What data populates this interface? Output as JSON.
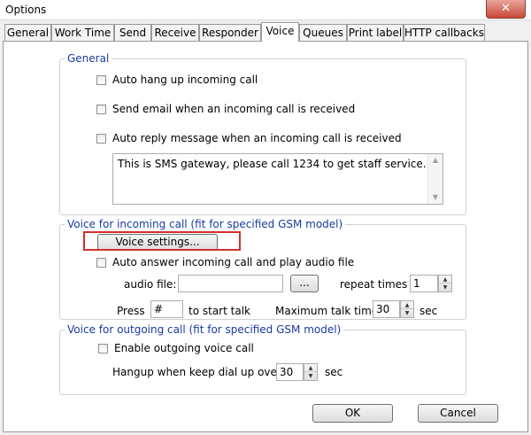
{
  "window": {
    "title": "Options",
    "close_glyph": "✕"
  },
  "tabs": [
    {
      "label": "General"
    },
    {
      "label": "Work Time"
    },
    {
      "label": "Send"
    },
    {
      "label": "Receive"
    },
    {
      "label": "Responder"
    },
    {
      "label": "Voice",
      "active": true
    },
    {
      "label": "Queues"
    },
    {
      "label": "Print label"
    },
    {
      "label": "HTTP callbacks"
    }
  ],
  "general": {
    "legend": "General",
    "auto_hangup_label": "Auto hang up incoming call",
    "send_email_label": "Send email when an incoming call is received",
    "auto_reply_label": "Auto reply message when an incoming call is received",
    "reply_message": "This is SMS gateway, please call 1234 to get staff service."
  },
  "incoming": {
    "legend": "Voice for incoming call (fit for specified GSM model)",
    "voice_settings_label": "Voice settings...",
    "auto_answer_label": "Auto answer incoming call and play audio file",
    "audio_file_label": "audio file:",
    "audio_file_value": "",
    "browse_label": "...",
    "repeat_times_label": "repeat times",
    "repeat_times_value": "1",
    "press_label": "Press",
    "press_value": "#",
    "to_start_talk_label": "to start talk",
    "max_talk_time_label": "Maximum talk time",
    "max_talk_time_value": "30",
    "sec_label": "sec"
  },
  "outgoing": {
    "legend": "Voice for outgoing call (fit for specified GSM model)",
    "enable_label": "Enable outgoing voice call",
    "hangup_label": "Hangup when keep dial up over",
    "hangup_value": "30",
    "sec_label": "sec"
  },
  "footer": {
    "ok_label": "OK",
    "cancel_label": "Cancel"
  },
  "colors": {
    "legend_text": "#1a3aa0",
    "highlight_border": "#d0312d",
    "close_button": "#c7483a"
  }
}
